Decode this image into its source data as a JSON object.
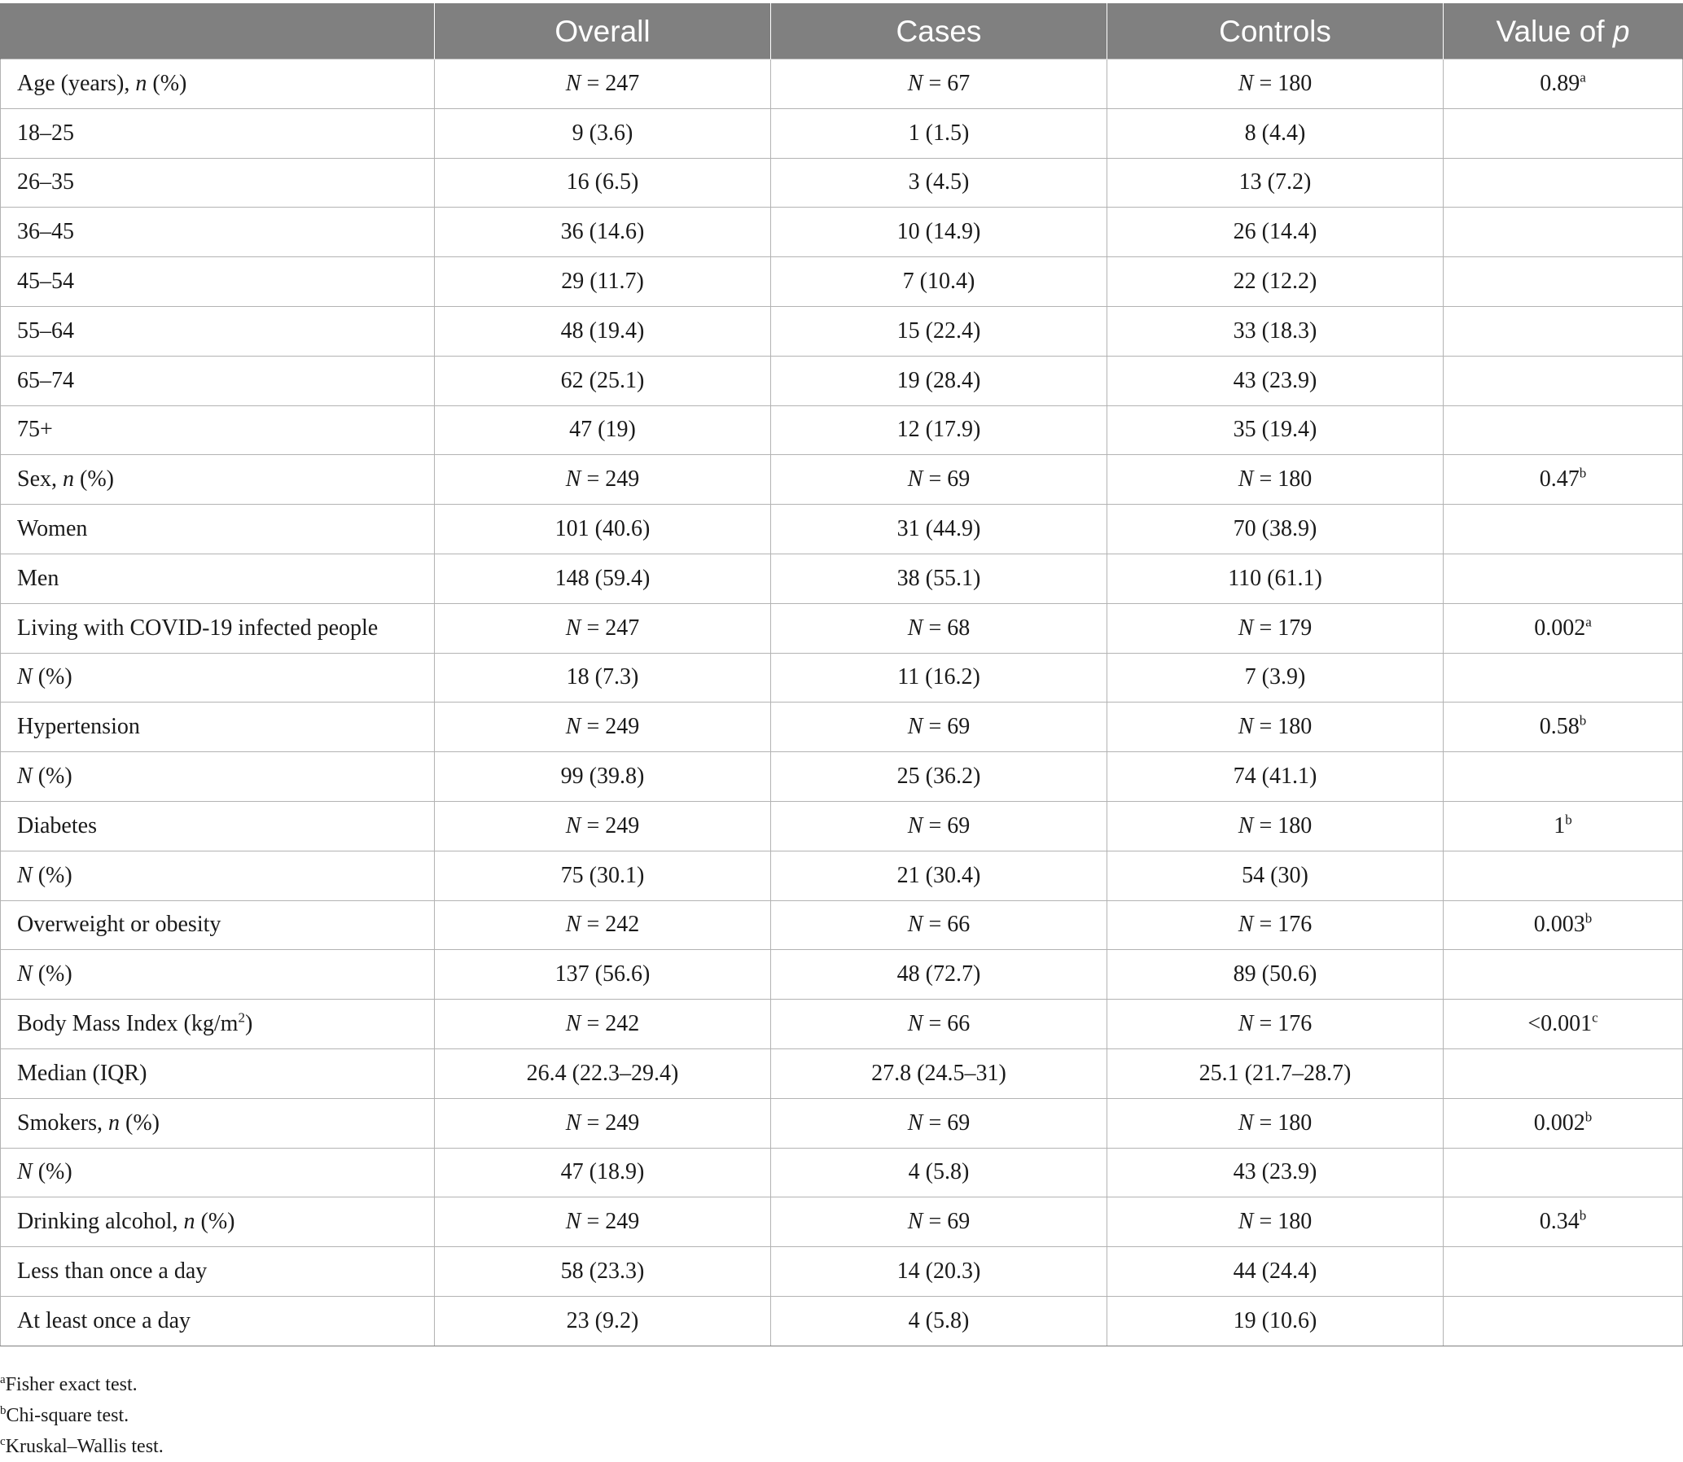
{
  "header": [
    "Overall",
    "Cases",
    "Controls",
    "Value of"
  ],
  "header_p": "p",
  "rows": [
    {
      "label": "Age (years), ",
      "label_it": "n",
      "label_post": " (%)",
      "n_row": true,
      "overall": "247",
      "cases": "67",
      "controls": "180",
      "p": "0.89",
      "p_sup": "a"
    },
    {
      "label": "18–25",
      "overall": "9 (3.6)",
      "cases": "1 (1.5)",
      "controls": "8 (4.4)",
      "p": ""
    },
    {
      "label": "26–35",
      "overall": "16 (6.5)",
      "cases": "3 (4.5)",
      "controls": "13 (7.2)",
      "p": ""
    },
    {
      "label": "36–45",
      "overall": "36 (14.6)",
      "cases": "10 (14.9)",
      "controls": "26 (14.4)",
      "p": ""
    },
    {
      "label": "45–54",
      "overall": "29 (11.7)",
      "cases": "7 (10.4)",
      "controls": "22 (12.2)",
      "p": ""
    },
    {
      "label": "55–64",
      "overall": "48 (19.4)",
      "cases": "15 (22.4)",
      "controls": "33 (18.3)",
      "p": ""
    },
    {
      "label": "65–74",
      "overall": "62 (25.1)",
      "cases": "19 (28.4)",
      "controls": "43 (23.9)",
      "p": ""
    },
    {
      "label": "75+",
      "overall": "47 (19)",
      "cases": "12 (17.9)",
      "controls": "35 (19.4)",
      "p": ""
    },
    {
      "label": "Sex, ",
      "label_it": "n",
      "label_post": " (%)",
      "n_row": true,
      "overall": "249",
      "cases": "69",
      "controls": "180",
      "p": "0.47",
      "p_sup": "b"
    },
    {
      "label": "Women",
      "overall": "101 (40.6)",
      "cases": "31 (44.9)",
      "controls": "70 (38.9)",
      "p": ""
    },
    {
      "label": "Men",
      "overall": "148 (59.4)",
      "cases": "38 (55.1)",
      "controls": "110 (61.1)",
      "p": ""
    },
    {
      "label": "Living with COVID-19 infected people",
      "n_row": true,
      "overall": "247",
      "cases": "68",
      "controls": "179",
      "p": "0.002",
      "p_sup": "a"
    },
    {
      "label_lead_it": "N",
      "label": " (%)",
      "overall": "18 (7.3)",
      "cases": "11 (16.2)",
      "controls": "7 (3.9)",
      "p": ""
    },
    {
      "label": "Hypertension",
      "n_row": true,
      "overall": "249",
      "cases": "69",
      "controls": "180",
      "p": "0.58",
      "p_sup": "b"
    },
    {
      "label_lead_it": "N",
      "label": " (%)",
      "overall": "99 (39.8)",
      "cases": "25 (36.2)",
      "controls": "74 (41.1)",
      "p": ""
    },
    {
      "label": "Diabetes",
      "n_row": true,
      "overall": "249",
      "cases": "69",
      "controls": "180",
      "p": "1",
      "p_sup": "b"
    },
    {
      "label_lead_it": "N",
      "label": " (%)",
      "overall": "75 (30.1)",
      "cases": "21 (30.4)",
      "controls": "54 (30)",
      "p": ""
    },
    {
      "label": "Overweight or obesity",
      "n_row": true,
      "overall": "242",
      "cases": "66",
      "controls": "176",
      "p": "0.003",
      "p_sup": "b"
    },
    {
      "label_lead_it": "N",
      "label": " (%)",
      "overall": "137 (56.6)",
      "cases": "48 (72.7)",
      "controls": "89 (50.6)",
      "p": ""
    },
    {
      "label": "Body Mass Index (kg/m",
      "label_sup": "2",
      "label_post": ")",
      "n_row": true,
      "overall": "242",
      "cases": "66",
      "controls": "176",
      "p": "<0.001",
      "p_sup": "c"
    },
    {
      "label": "Median (IQR)",
      "overall": "26.4 (22.3–29.4)",
      "cases": "27.8 (24.5–31)",
      "controls": "25.1 (21.7–28.7)",
      "p": ""
    },
    {
      "label": "Smokers, ",
      "label_it": "n",
      "label_post": " (%)",
      "n_row": true,
      "overall": "249",
      "cases": "69",
      "controls": "180",
      "p": "0.002",
      "p_sup": "b"
    },
    {
      "label_lead_it": "N",
      "label": " (%)",
      "overall": "47 (18.9)",
      "cases": "4 (5.8)",
      "controls": "43 (23.9)",
      "p": ""
    },
    {
      "label": "Drinking alcohol, ",
      "label_it": "n",
      "label_post": " (%)",
      "n_row": true,
      "overall": "249",
      "cases": "69",
      "controls": "180",
      "p": "0.34",
      "p_sup": "b"
    },
    {
      "label": "Less than once a day",
      "overall": "58 (23.3)",
      "cases": "14 (20.3)",
      "controls": "44 (24.4)",
      "p": ""
    },
    {
      "label": "At least once a day",
      "overall": "23 (9.2)",
      "cases": "4 (5.8)",
      "controls": "19 (10.6)",
      "p": ""
    }
  ],
  "n_prefix": "N",
  "n_eq": " = ",
  "footnotes": [
    {
      "mark": "a",
      "text": "Fisher exact test."
    },
    {
      "mark": "b",
      "text": "Chi-square test."
    },
    {
      "mark": "c",
      "text": "Kruskal–Wallis test."
    }
  ]
}
